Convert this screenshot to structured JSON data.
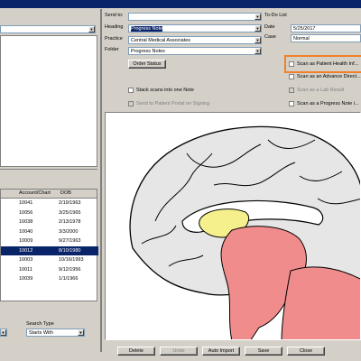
{
  "form": {
    "send_to_label": "Send to:",
    "send_to_value": "",
    "heading_label": "Heading",
    "heading_value": "Progress Note",
    "practice_label": "Practice",
    "practice_value": "Central Medical Associates",
    "folder_label": "Folder",
    "folder_value": "Progress Notes",
    "order_status_button": "Order Status",
    "todo_label": "To-Do List",
    "date_label": "Date",
    "date_value": "5/25/2017",
    "case_label": "Case",
    "case_value": "Normal"
  },
  "checkboxes": {
    "patient_health": "Scan as Patient Health Inf...",
    "advance_directive": "Scan as an Advance Direct...",
    "lab_result": "Scan as a Lab Result",
    "progress_note": "Scan as a Progress Note i...",
    "stack_scans": "Stack scans into one Note",
    "send_portal": "Send to Patient Portal on Signing"
  },
  "patients": {
    "headers": [
      "Account/Chart",
      "DOB"
    ],
    "rows": [
      {
        "account": "10041",
        "dob": "2/19/1963"
      },
      {
        "account": "10056",
        "dob": "3/25/1965"
      },
      {
        "account": "10038",
        "dob": "2/13/1978"
      },
      {
        "account": "10040",
        "dob": "3/3/2000"
      },
      {
        "account": "10009",
        "dob": "9/27/1963"
      },
      {
        "account": "10012",
        "dob": "8/10/1980"
      },
      {
        "account": "10003",
        "dob": "10/16/1993"
      },
      {
        "account": "10011",
        "dob": "9/12/1956"
      },
      {
        "account": "10039",
        "dob": "1/1/1966"
      }
    ],
    "selected_index": 5
  },
  "search": {
    "search_type_label": "Search Type",
    "search_type_value": "Starts With"
  },
  "buttons": {
    "delete": "Delete",
    "undo": "Undo",
    "auto_import": "Auto Import",
    "save": "Save",
    "close": "Close"
  },
  "colors": {
    "highlight_box": "#f0802a",
    "selection": "#0a246a",
    "brainstem": "#f08c8c",
    "corpus": "#f5f08c"
  }
}
